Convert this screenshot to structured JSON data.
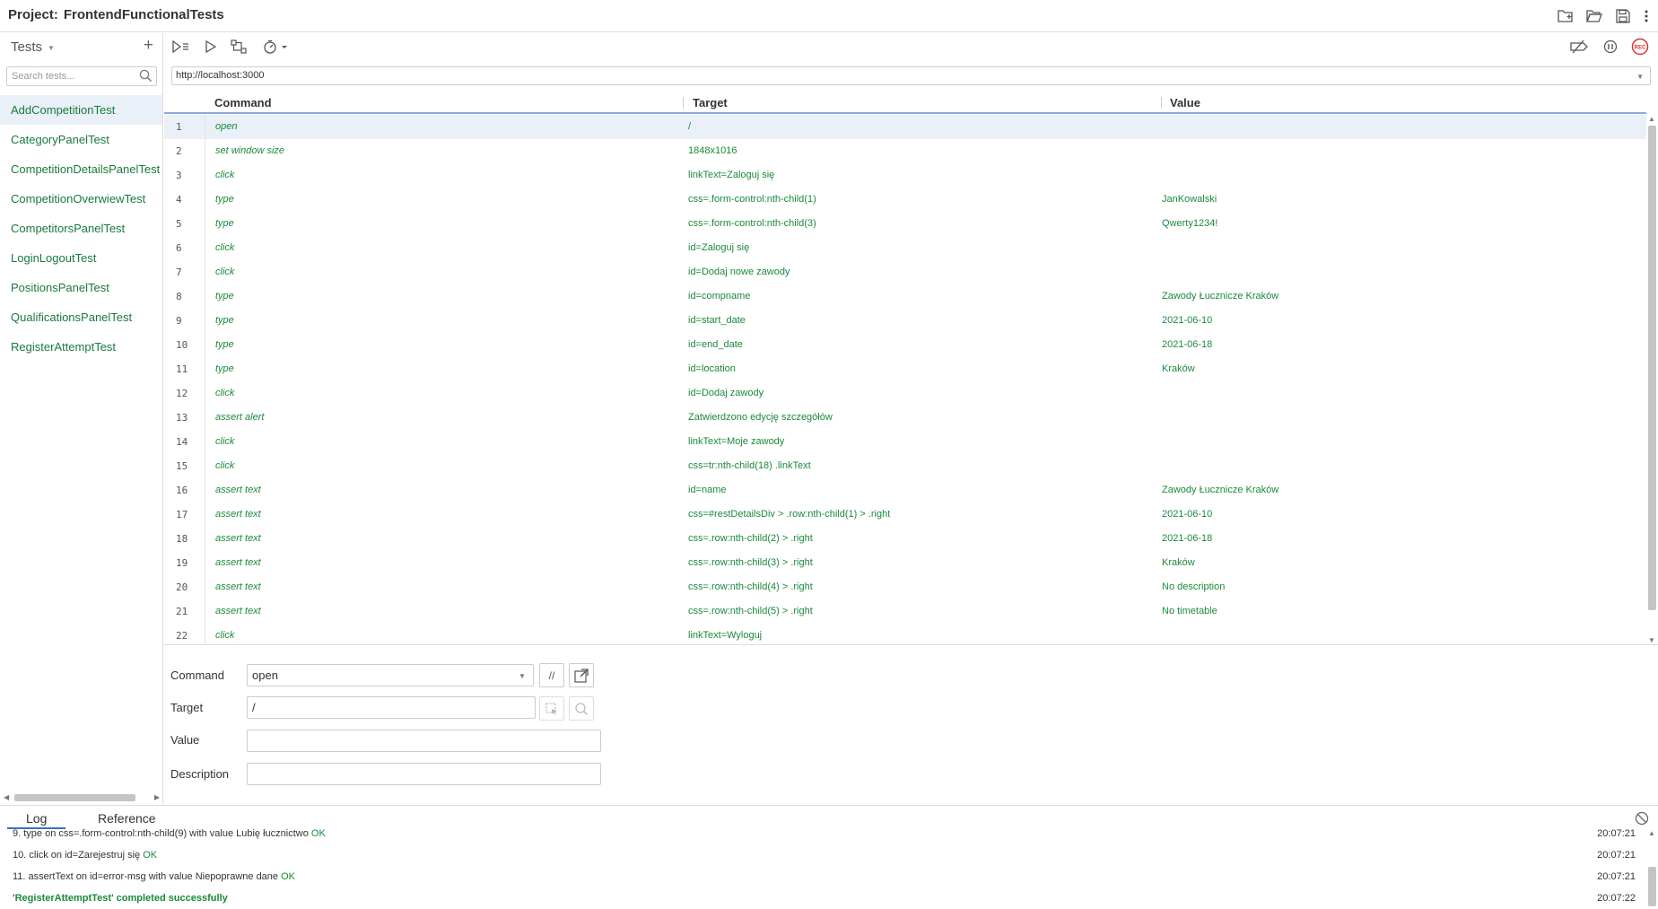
{
  "header": {
    "project_label": "Project:",
    "project_name": "FrontendFunctionalTests"
  },
  "sidebar": {
    "title": "Tests",
    "search_placeholder": "Search tests...",
    "tests": [
      "AddCompetitionTest",
      "CategoryPanelTest",
      "CompetitionDetailsPanelTest",
      "CompetitionOverwiewTest",
      "CompetitorsPanelTest",
      "LoginLogoutTest",
      "PositionsPanelTest",
      "QualificationsPanelTest",
      "RegisterAttemptTest"
    ],
    "active_index": 0
  },
  "toolbar": {
    "url": "http://localhost:3000"
  },
  "table": {
    "headers": {
      "command": "Command",
      "target": "Target",
      "value": "Value"
    },
    "rows": [
      {
        "num": "1",
        "command": "open",
        "target": "/",
        "value": ""
      },
      {
        "num": "2",
        "command": "set window size",
        "target": "1848x1016",
        "value": ""
      },
      {
        "num": "3",
        "command": "click",
        "target": "linkText=Zaloguj się",
        "value": ""
      },
      {
        "num": "4",
        "command": "type",
        "target": "css=.form-control:nth-child(1)",
        "value": "JanKowalski"
      },
      {
        "num": "5",
        "command": "type",
        "target": "css=.form-control:nth-child(3)",
        "value": "Qwerty1234!"
      },
      {
        "num": "6",
        "command": "click",
        "target": "id=Zaloguj się",
        "value": ""
      },
      {
        "num": "7",
        "command": "click",
        "target": "id=Dodaj nowe zawody",
        "value": ""
      },
      {
        "num": "8",
        "command": "type",
        "target": "id=compname",
        "value": "Zawody Łucznicze Kraków"
      },
      {
        "num": "9",
        "command": "type",
        "target": "id=start_date",
        "value": "2021-06-10"
      },
      {
        "num": "10",
        "command": "type",
        "target": "id=end_date",
        "value": "2021-06-18"
      },
      {
        "num": "11",
        "command": "type",
        "target": "id=location",
        "value": "Kraków"
      },
      {
        "num": "12",
        "command": "click",
        "target": "id=Dodaj zawody",
        "value": ""
      },
      {
        "num": "13",
        "command": "assert alert",
        "target": "Zatwierdzono edycję szczegółów",
        "value": ""
      },
      {
        "num": "14",
        "command": "click",
        "target": "linkText=Moje zawody",
        "value": ""
      },
      {
        "num": "15",
        "command": "click",
        "target": "css=tr:nth-child(18) .linkText",
        "value": ""
      },
      {
        "num": "16",
        "command": "assert text",
        "target": "id=name",
        "value": "Zawody Łucznicze Kraków"
      },
      {
        "num": "17",
        "command": "assert text",
        "target": "css=#restDetailsDiv > .row:nth-child(1) > .right",
        "value": "2021-06-10"
      },
      {
        "num": "18",
        "command": "assert text",
        "target": "css=.row:nth-child(2) > .right",
        "value": "2021-06-18"
      },
      {
        "num": "19",
        "command": "assert text",
        "target": "css=.row:nth-child(3) > .right",
        "value": "Kraków"
      },
      {
        "num": "20",
        "command": "assert text",
        "target": "css=.row:nth-child(4) > .right",
        "value": "No description"
      },
      {
        "num": "21",
        "command": "assert text",
        "target": "css=.row:nth-child(5) > .right",
        "value": "No timetable"
      },
      {
        "num": "22",
        "command": "click",
        "target": "linkText=Wyloguj",
        "value": ""
      }
    ],
    "selected_index": 0
  },
  "editor": {
    "command_label": "Command",
    "command_value": "open",
    "target_label": "Target",
    "target_value": "/",
    "value_label": "Value",
    "value_value": "",
    "description_label": "Description",
    "description_value": "",
    "comment_button": "//"
  },
  "log": {
    "tabs": [
      "Log",
      "Reference"
    ],
    "lines": [
      {
        "text": "9.  type on css=.form-control:nth-child(9) with value Lubię łucznictwo ",
        "status": "OK",
        "time": "20:07:21"
      },
      {
        "text": "10. click on id=Zarejestruj się ",
        "status": "OK",
        "time": "20:07:21"
      },
      {
        "text": "11. assertText on id=error-msg with value Niepoprawne dane ",
        "status": "OK",
        "time": "20:07:21"
      }
    ],
    "summary": {
      "text": "'RegisterAttemptTest' completed successfully",
      "time": "20:07:22"
    }
  },
  "colors": {
    "accent": "#3b6fc6",
    "ok_green": "#1a8a3a",
    "record_red": "#d9342b",
    "selected_bg": "#e9f0f8"
  },
  "icons": {
    "header": [
      "new-project-icon",
      "open-project-icon",
      "save-project-icon",
      "more-menu-icon"
    ],
    "toolbar": [
      "run-all-icon",
      "run-current-icon",
      "step-over-icon",
      "speed-icon",
      "disable-breakpoints-icon",
      "pause-icon",
      "record-icon"
    ]
  }
}
